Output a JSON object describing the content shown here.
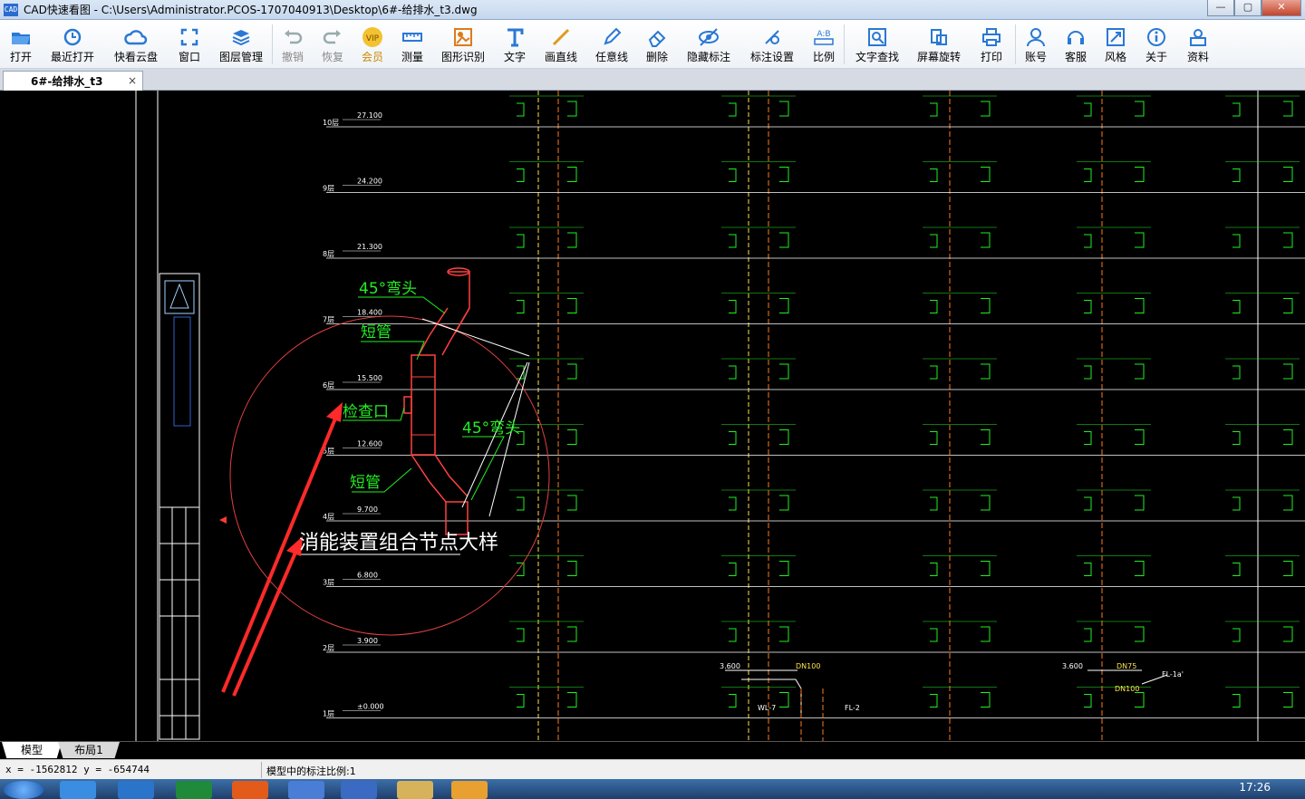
{
  "window": {
    "title": "CAD快速看图 - C:\\Users\\Administrator.PCOS-1707040913\\Desktop\\6#-给排水_t3.dwg",
    "minimize": "—",
    "maximize": "▢",
    "close": "✕"
  },
  "toolbar": {
    "open": "打开",
    "recent": "最近打开",
    "cloud": "快看云盘",
    "window": "窗口",
    "layers": "图层管理",
    "undo": "撤销",
    "redo": "恢复",
    "vip": "会员",
    "measure": "测量",
    "recognize": "图形识别",
    "text": "文字",
    "line": "画直线",
    "freeline": "任意线",
    "delete": "删除",
    "hide_marks": "隐藏标注",
    "mark_settings": "标注设置",
    "scale": "比例",
    "find_text": "文字查找",
    "rotate": "屏幕旋转",
    "print": "打印",
    "account": "账号",
    "service": "客服",
    "style": "风格",
    "about": "关于",
    "resources": "资料"
  },
  "tabs": {
    "document": "6#-给排水_t3",
    "close": "×"
  },
  "drawing": {
    "levels": [
      {
        "floor": "10层",
        "elev": "27.100"
      },
      {
        "floor": "9层",
        "elev": "24.200"
      },
      {
        "floor": "8层",
        "elev": "21.300"
      },
      {
        "floor": "7层",
        "elev": "18.400"
      },
      {
        "floor": "6层",
        "elev": "15.500"
      },
      {
        "floor": "5层",
        "elev": "12.600"
      },
      {
        "floor": "4层",
        "elev": "9.700"
      },
      {
        "floor": "3层",
        "elev": "6.800"
      },
      {
        "floor": "2层",
        "elev": "3.900"
      },
      {
        "floor": "1层",
        "elev": "±0.000"
      }
    ],
    "detail_title": "消能装置组合节点大样",
    "label_elbow1": "45°弯头",
    "label_short1": "短管",
    "label_inspect": "检查口",
    "label_elbow2": "45°弯头",
    "label_short2": "短管",
    "dn_labels": [
      "DN100",
      "DN75",
      "DN100"
    ],
    "pipe_labels": [
      "WL-7",
      "FL-2",
      "FL-1a'"
    ],
    "base_elev": "3.600"
  },
  "layout_tabs": {
    "model": "模型",
    "layout1": "布局1"
  },
  "status": {
    "coords": "x = -1562812  y = -654744",
    "scale_text": "模型中的标注比例:1"
  },
  "taskbar": {
    "time": "17:26"
  }
}
